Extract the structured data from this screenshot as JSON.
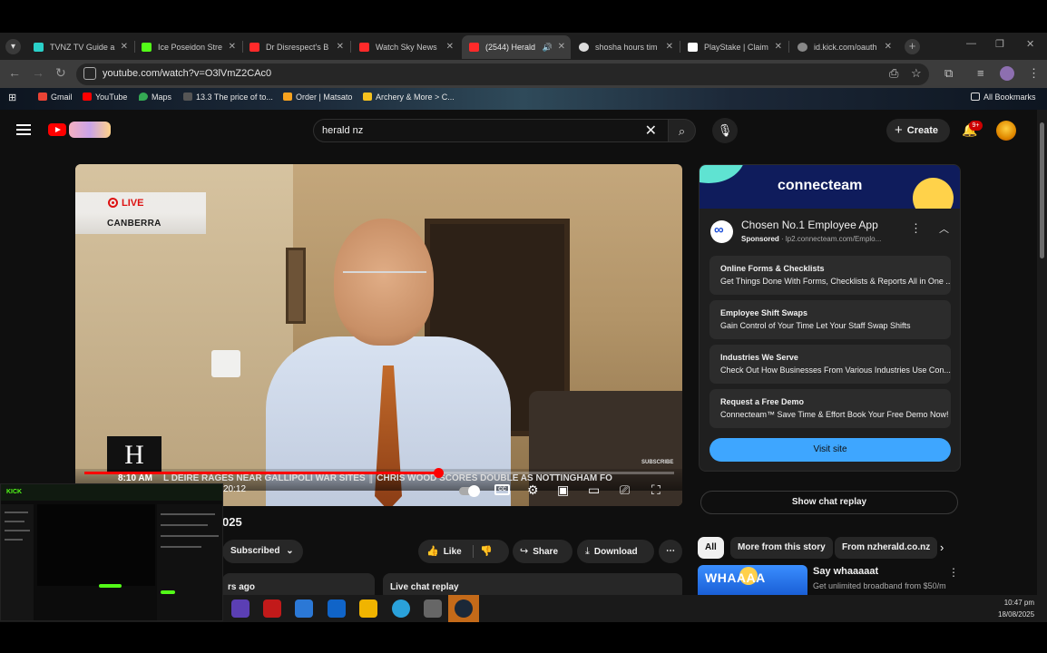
{
  "browser": {
    "tabs": [
      {
        "label": "TVNZ TV Guide a",
        "color": "#2ad1c9",
        "active": false
      },
      {
        "label": "Ice Poseidon Stre",
        "color": "#53fc18",
        "active": false
      },
      {
        "label": "Dr Disrespect's B",
        "color": "#ff2a2a",
        "active": false
      },
      {
        "label": "Watch Sky News",
        "color": "#ff2a2a",
        "active": false
      },
      {
        "label": "(2544) Herald",
        "color": "#ff2a2a",
        "active": true
      },
      {
        "label": "shosha hours tim",
        "color": "#dddddd",
        "active": false
      },
      {
        "label": "PlayStake | Claim",
        "color": "#ffffff",
        "active": false
      },
      {
        "label": "id.kick.com/oauth",
        "color": "#888888",
        "active": false
      }
    ],
    "url": "youtube.com/watch?v=O3lVmZ2CAc0",
    "bookmarks": [
      {
        "label": "Gmail",
        "color": "#ea4335"
      },
      {
        "label": "YouTube",
        "color": "#ff0000"
      },
      {
        "label": "Maps",
        "color": "#34a853"
      },
      {
        "label": "13.3 The price of to...",
        "color": "#555555"
      },
      {
        "label": "Order | Matsato",
        "color": "#f6a21e"
      },
      {
        "label": "Archery & More > C...",
        "color": "#f6c21e"
      }
    ],
    "all_bookmarks": "All Bookmarks"
  },
  "youtube": {
    "search_query": "herald nz",
    "create_label": "Create",
    "notif_count": "9+",
    "video": {
      "live_label": "LIVE",
      "location": "CANBERRA",
      "logo_letter": "H",
      "subscribe_watermark": "SUBSCRIBE",
      "ticker_time": "8:10 AM",
      "ticker_text": "L DEIRE RAGES NEAR GALLIPOLI WAR SITES  ║  CHRIS WOOD SCORES DOUBLE AS NOTTINGHAM FO",
      "timecode": "20:12",
      "progress": 0.6
    },
    "title_fragment": "025",
    "subscribed_label": "Subscribed",
    "like_label": "Like",
    "share_label": "Share",
    "download_label": "Download",
    "desc_fragment": "rs ago",
    "live_chat_replay": "Live chat replay",
    "show_chat_replay": "Show chat replay",
    "ad": {
      "brand": "connecteam",
      "title": "Chosen No.1 Employee App",
      "sponsored": "Sponsored",
      "domain": "· lp2.connecteam.com/Emplo...",
      "links": [
        {
          "heading": "Online Forms & Checklists",
          "sub": "Get Things Done With Forms, Checklists & Reports All in One ..."
        },
        {
          "heading": "Employee Shift Swaps",
          "sub": "Gain Control of Your Time Let Your Staff Swap Shifts"
        },
        {
          "heading": "Industries We Serve",
          "sub": "Check Out How Businesses From Various Industries Use Con..."
        },
        {
          "heading": "Request a Free Demo",
          "sub": "Connecteam™ Save Time & Effort Book Your Free Demo Now!"
        }
      ],
      "visit_label": "Visit site"
    },
    "chips": [
      "All",
      "More from this story",
      "From nzherald.co.nz"
    ],
    "rec": {
      "thumb_text": "WHAAAA",
      "title": "Say whaaaaat",
      "sub": "Get unlimited broadband from $50/m"
    }
  },
  "taskbar": {
    "time": "10:47 pm",
    "date": "18/08/2025"
  },
  "overlay": {
    "logo": "KICK"
  }
}
